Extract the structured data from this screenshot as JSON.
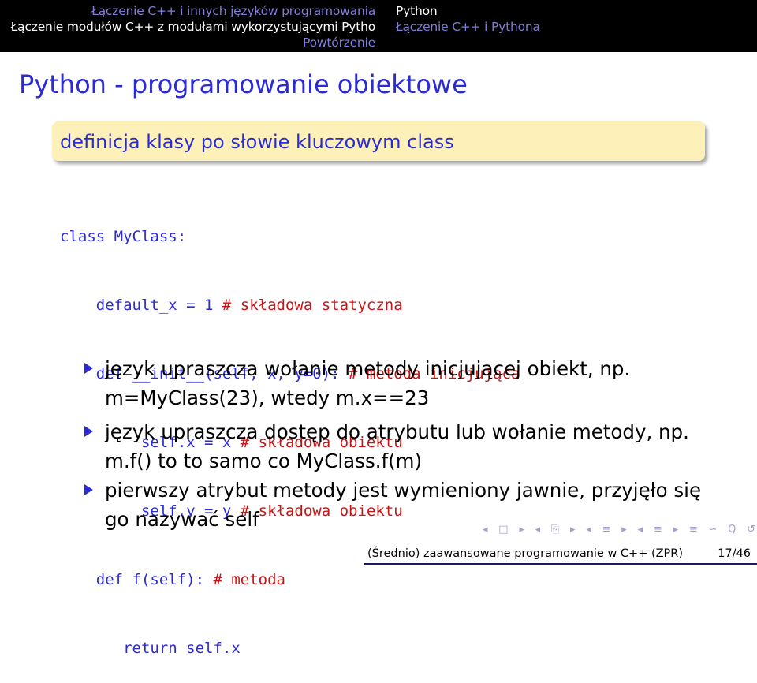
{
  "headline": {
    "sections_left": [
      "Łączenie C++ i innych języków programowania",
      "Łączenie modułów C++ z modułami wykorzystującymi Pytho",
      "Powtórzenie"
    ],
    "sections_right": [
      "Python",
      "Łączenie C++ i Pythona"
    ]
  },
  "frame_title": "Python - programowanie obiektowe",
  "block_title": "definicja klasy po słowie kluczowym class",
  "code": [
    {
      "code": "class MyClass:",
      "comment": ""
    },
    {
      "code": "    default_x = 1 ",
      "comment": "# składowa statyczna"
    },
    {
      "code": "    def __init__(self, x, y=0): ",
      "comment": "# metoda inicjująca"
    },
    {
      "code": "         self.x = x ",
      "comment": "# składowa obiektu"
    },
    {
      "code": "         self.y = y ",
      "comment": "# składowa obiektu"
    },
    {
      "code": "    def f(self): ",
      "comment": "# metoda"
    },
    {
      "code": "       return self.x",
      "comment": ""
    }
  ],
  "bullets": [
    {
      "line1": "język upraszcza wołanie metody inicjującej obiekt, np.",
      "line2": "m=MyClass(23), wtedy m.x==23"
    },
    {
      "line1": "język upraszcza dostęp do atrybutu lub wołanie metody, np.",
      "line2": "m.f() to to samo co MyClass.f(m)"
    },
    {
      "line1": "pierwszy atrybut metody jest wymieniony jawnie, przyjęło się",
      "line2": "go nazywać self"
    }
  ],
  "nav_symbols": [
    "◂",
    "□",
    "▸",
    "◂",
    "⎘",
    "▸",
    "◂",
    "≡",
    "▸",
    "◂",
    "≡",
    "▸",
    "≡",
    "∽",
    "Q",
    "↺"
  ],
  "footer": {
    "title": "(Średnio) zaawansowane programowanie w C++ (ZPR)",
    "page": "17/46"
  },
  "colors": {
    "headline_bg": "#000000",
    "title_blue": "#2b2bd6",
    "block_bg": "#fdf0b8",
    "comment_red": "#c81414"
  }
}
